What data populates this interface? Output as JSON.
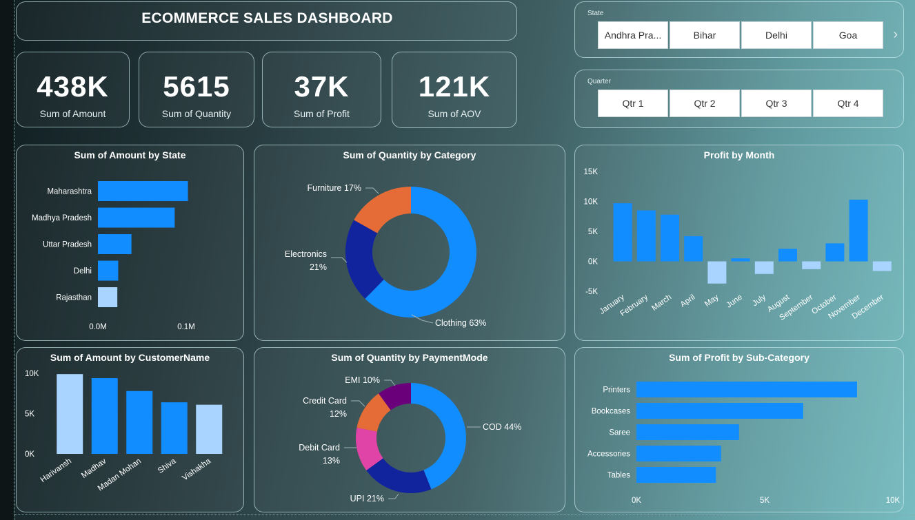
{
  "dashboard": {
    "title": "ECOMMERCE SALES DASHBOARD"
  },
  "kpis": [
    {
      "value": "438K",
      "label": "Sum of Amount"
    },
    {
      "value": "5615",
      "label": "Sum of Quantity"
    },
    {
      "value": "37K",
      "label": "Sum of Profit"
    },
    {
      "value": "121K",
      "label": "Sum of AOV"
    }
  ],
  "slicers": {
    "state": {
      "title": "State",
      "options": [
        "Andhra Pra...",
        "Bihar",
        "Delhi",
        "Goa"
      ],
      "next_icon": "chevron-right-icon"
    },
    "quarter": {
      "title": "Quarter",
      "options": [
        "Qtr 1",
        "Qtr 2",
        "Qtr 3",
        "Qtr 4"
      ]
    }
  },
  "colors": {
    "primary": "#118dff",
    "light": "#a9d4ff",
    "navy": "#12239e",
    "orange": "#e66c37",
    "magenta": "#e044a7",
    "purple": "#6b007b"
  },
  "chart_data": [
    {
      "id": "amount_by_state",
      "type": "bar",
      "orientation": "horizontal",
      "title": "Sum of Amount by State",
      "categories": [
        "Maharashtra",
        "Madhya Pradesh",
        "Uttar Pradesh",
        "Delhi",
        "Rajasthan"
      ],
      "values": [
        0.102,
        0.087,
        0.038,
        0.023,
        0.022
      ],
      "xticks": [
        "0.0M",
        "0.1M"
      ],
      "xlim": [
        0,
        0.1
      ]
    },
    {
      "id": "quantity_by_category",
      "type": "pie",
      "donut": true,
      "title": "Sum of Quantity by Category",
      "labels": [
        "Clothing",
        "Electronics",
        "Furniture"
      ],
      "values": [
        63,
        21,
        17
      ],
      "label_text": [
        "Clothing 63%",
        "Electronics",
        "Furniture 17%"
      ],
      "label_pct": [
        "",
        "21%",
        ""
      ]
    },
    {
      "id": "profit_by_month",
      "type": "bar",
      "title": "Profit by Month",
      "categories": [
        "January",
        "February",
        "March",
        "April",
        "May",
        "June",
        "July",
        "August",
        "September",
        "October",
        "November",
        "December"
      ],
      "values": [
        9700,
        8500,
        7800,
        4200,
        -3700,
        500,
        -2100,
        2100,
        -1300,
        3000,
        10300,
        -1600
      ],
      "yticks": [
        "15K",
        "10K",
        "5K",
        "0K",
        "-5K"
      ],
      "ylim": [
        -5000,
        15000
      ]
    },
    {
      "id": "amount_by_customer",
      "type": "bar",
      "title": "Sum of Amount by CustomerName",
      "categories": [
        "Harivansh",
        "Madhav",
        "Madan Mohan",
        "Shiva",
        "Vishakha"
      ],
      "values": [
        9900,
        9400,
        7800,
        6400,
        6100
      ],
      "yticks": [
        "10K",
        "5K",
        "0K"
      ],
      "ylim": [
        0,
        10000
      ]
    },
    {
      "id": "quantity_by_paymentmode",
      "type": "pie",
      "donut": true,
      "title": "Sum of Quantity by PaymentMode",
      "labels": [
        "COD",
        "UPI",
        "Debit Card",
        "Credit Card",
        "EMI"
      ],
      "values": [
        44,
        21,
        13,
        12,
        10
      ],
      "label_text": [
        "COD 44%",
        "UPI 21%",
        "Debit Card",
        "Credit Card",
        "EMI 10%"
      ],
      "label_pct": [
        "",
        "",
        "13%",
        "12%",
        ""
      ]
    },
    {
      "id": "profit_by_subcategory",
      "type": "bar",
      "orientation": "horizontal",
      "title": "Sum of Profit by Sub-Category",
      "categories": [
        "Printers",
        "Bookcases",
        "Saree",
        "Accessories",
        "Tables"
      ],
      "values": [
        8600,
        6500,
        4000,
        3300,
        3100
      ],
      "xticks": [
        "0K",
        "5K",
        "10K"
      ],
      "xlim": [
        0,
        10000
      ]
    }
  ]
}
